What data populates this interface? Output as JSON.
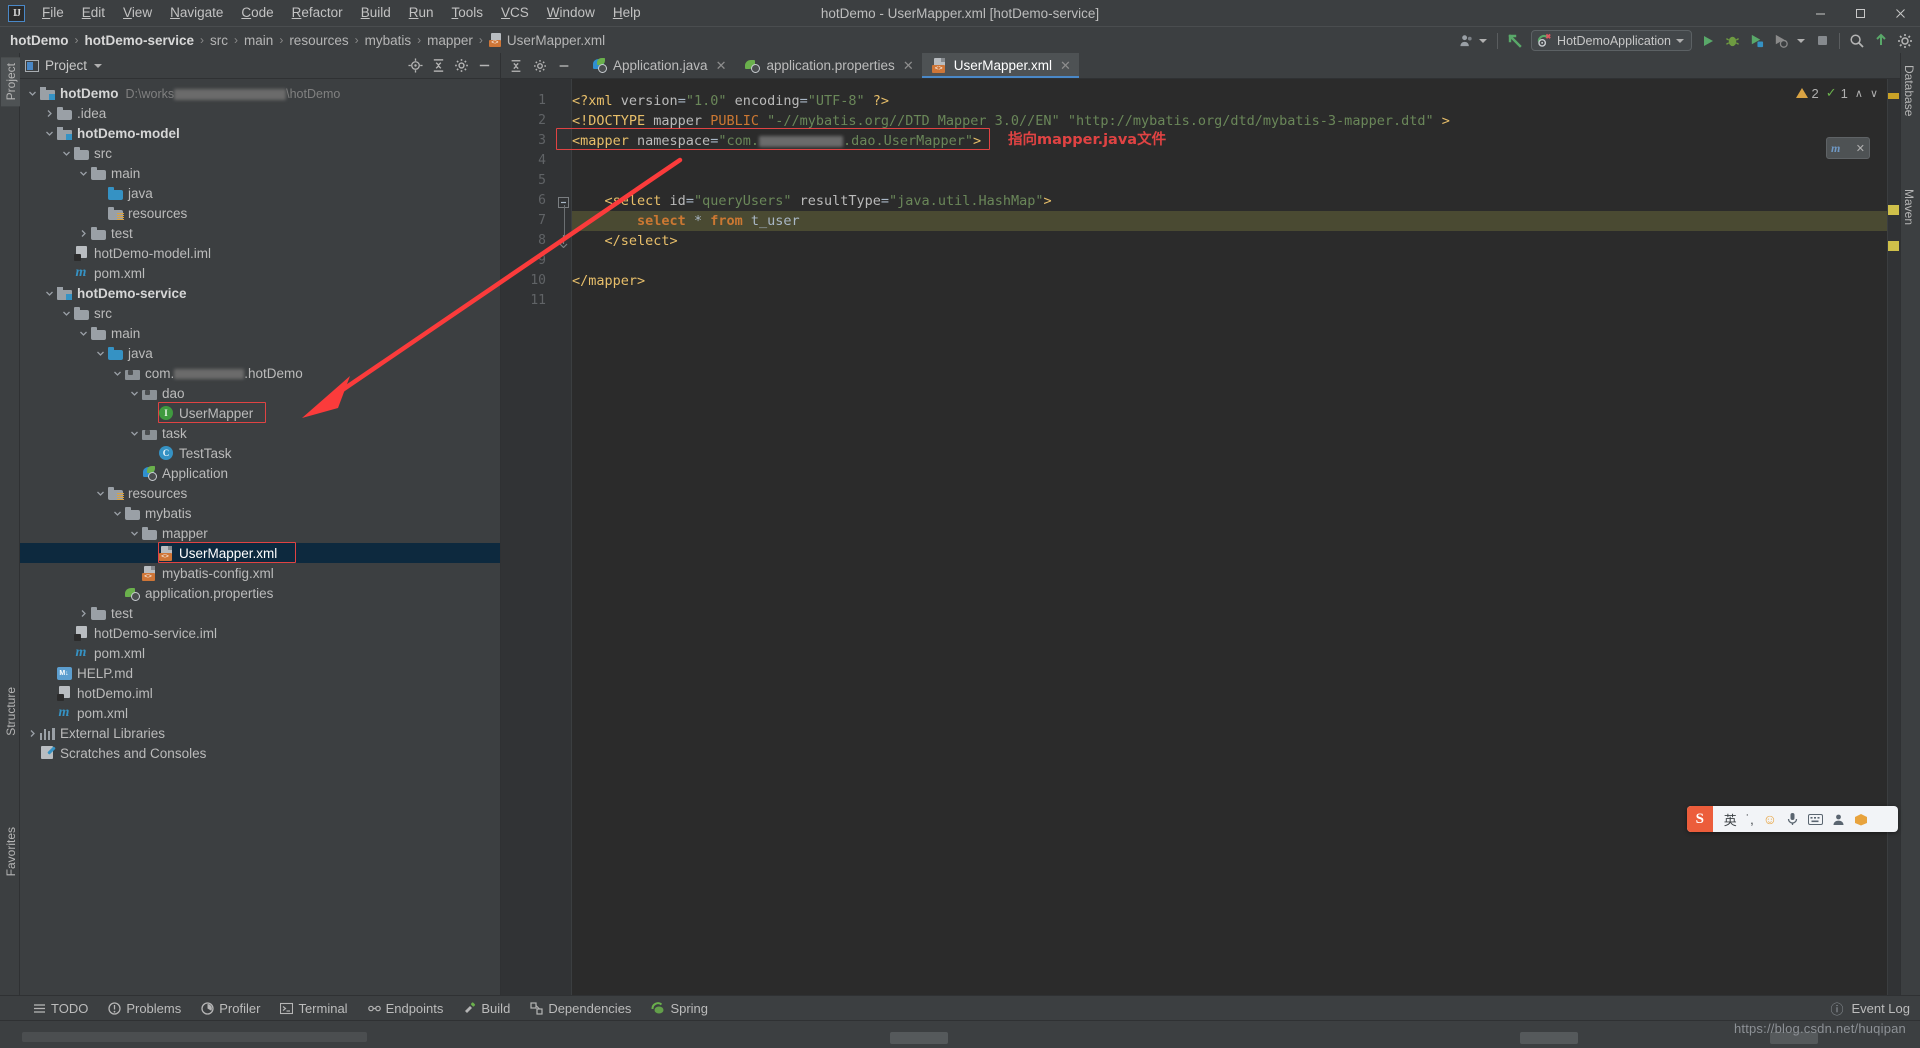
{
  "window": {
    "title": "hotDemo - UserMapper.xml [hotDemo-service]",
    "minimize": "—",
    "maximize": "☐",
    "close": "✕"
  },
  "menu": [
    {
      "label": "File"
    },
    {
      "label": "Edit"
    },
    {
      "label": "View"
    },
    {
      "label": "Navigate"
    },
    {
      "label": "Code"
    },
    {
      "label": "Refactor"
    },
    {
      "label": "Build"
    },
    {
      "label": "Run"
    },
    {
      "label": "Tools"
    },
    {
      "label": "VCS"
    },
    {
      "label": "Window"
    },
    {
      "label": "Help"
    }
  ],
  "breadcrumb": [
    {
      "label": "hotDemo",
      "bold": true
    },
    {
      "label": "hotDemo-service",
      "bold": true
    },
    {
      "label": "src",
      "bold": false
    },
    {
      "label": "main",
      "bold": false
    },
    {
      "label": "resources",
      "bold": false
    },
    {
      "label": "mybatis",
      "bold": false
    },
    {
      "label": "mapper",
      "bold": false
    },
    {
      "label": "UserMapper.xml",
      "bold": false
    }
  ],
  "toolbar": {
    "run_config": "HotDemoApplication",
    "run_tooltip": "Run",
    "debug_tooltip": "Debug",
    "coverage_tooltip": "Run with Coverage",
    "profile_tooltip": "Profile",
    "stop_tooltip": "Stop",
    "search_tooltip": "Search Everywhere",
    "update_tooltip": "Update Project",
    "settings_tooltip": "Settings"
  },
  "project_panel": {
    "title": "Project",
    "locate_icon": "locate-icon",
    "collapse_icon": "collapse-all-icon",
    "settings_icon": "gear-icon",
    "hide_icon": "hide-icon",
    "tree": [
      {
        "depth": 0,
        "label": "hotDemo",
        "path": "D:\\works",
        "path_tail": "\\hotDemo",
        "icon": "module-folder",
        "arrow": "down",
        "bold": true,
        "blur": true
      },
      {
        "depth": 1,
        "label": ".idea",
        "icon": "folder",
        "arrow": "right",
        "bold": false
      },
      {
        "depth": 1,
        "label": "hotDemo-model",
        "icon": "module-folder",
        "arrow": "down",
        "bold": true
      },
      {
        "depth": 2,
        "label": "src",
        "icon": "folder",
        "arrow": "down",
        "bold": false
      },
      {
        "depth": 3,
        "label": "main",
        "icon": "folder",
        "arrow": "down",
        "bold": false
      },
      {
        "depth": 4,
        "label": "java",
        "icon": "source-folder",
        "arrow": "none",
        "bold": false
      },
      {
        "depth": 4,
        "label": "resources",
        "icon": "resource-folder",
        "arrow": "none",
        "bold": false
      },
      {
        "depth": 3,
        "label": "test",
        "icon": "folder",
        "arrow": "right",
        "bold": false
      },
      {
        "depth": 2,
        "label": "hotDemo-model.iml",
        "icon": "iml-file",
        "arrow": "none",
        "bold": false
      },
      {
        "depth": 2,
        "label": "pom.xml",
        "icon": "maven-file",
        "arrow": "none",
        "bold": false
      },
      {
        "depth": 1,
        "label": "hotDemo-service",
        "icon": "module-folder",
        "arrow": "down",
        "bold": true
      },
      {
        "depth": 2,
        "label": "src",
        "icon": "folder",
        "arrow": "down",
        "bold": false
      },
      {
        "depth": 3,
        "label": "main",
        "icon": "folder",
        "arrow": "down",
        "bold": false
      },
      {
        "depth": 4,
        "label": "java",
        "icon": "source-folder",
        "arrow": "down",
        "bold": false
      },
      {
        "depth": 5,
        "label": "com.",
        "label_tail": ".hotDemo",
        "icon": "package",
        "arrow": "down",
        "bold": false,
        "blur": true
      },
      {
        "depth": 6,
        "label": "dao",
        "icon": "package",
        "arrow": "down",
        "bold": false
      },
      {
        "depth": 7,
        "label": "UserMapper",
        "icon": "interface",
        "arrow": "none",
        "bold": false,
        "boxed": true
      },
      {
        "depth": 6,
        "label": "task",
        "icon": "package",
        "arrow": "down",
        "bold": false
      },
      {
        "depth": 7,
        "label": "TestTask",
        "icon": "class",
        "arrow": "none",
        "bold": false
      },
      {
        "depth": 6,
        "label": "Application",
        "icon": "spring-boot",
        "arrow": "none",
        "bold": false
      },
      {
        "depth": 4,
        "label": "resources",
        "icon": "resource-folder",
        "arrow": "down",
        "bold": false
      },
      {
        "depth": 5,
        "label": "mybatis",
        "icon": "folder",
        "arrow": "down",
        "bold": false
      },
      {
        "depth": 6,
        "label": "mapper",
        "icon": "folder",
        "arrow": "down",
        "bold": false
      },
      {
        "depth": 7,
        "label": "UserMapper.xml",
        "icon": "xml-file",
        "arrow": "none",
        "bold": false,
        "selected": true,
        "boxed": true
      },
      {
        "depth": 6,
        "label": "mybatis-config.xml",
        "icon": "xml-file",
        "arrow": "none",
        "bold": false
      },
      {
        "depth": 5,
        "label": "application.properties",
        "icon": "spring-properties",
        "arrow": "none",
        "bold": false
      },
      {
        "depth": 3,
        "label": "test",
        "icon": "folder",
        "arrow": "right",
        "bold": false
      },
      {
        "depth": 2,
        "label": "hotDemo-service.iml",
        "icon": "iml-file",
        "arrow": "none",
        "bold": false
      },
      {
        "depth": 2,
        "label": "pom.xml",
        "icon": "maven-file",
        "arrow": "none",
        "bold": false
      },
      {
        "depth": 1,
        "label": "HELP.md",
        "icon": "markdown-file",
        "arrow": "none",
        "bold": false
      },
      {
        "depth": 1,
        "label": "hotDemo.iml",
        "icon": "iml-file",
        "arrow": "none",
        "bold": false
      },
      {
        "depth": 1,
        "label": "pom.xml",
        "icon": "maven-file",
        "arrow": "none",
        "bold": false
      },
      {
        "depth": 0,
        "label": "External Libraries",
        "icon": "libraries",
        "arrow": "right",
        "bold": false
      },
      {
        "depth": 0,
        "label": "Scratches and Consoles",
        "icon": "scratches",
        "arrow": "none",
        "bold": false
      }
    ]
  },
  "editor": {
    "tabs": [
      {
        "label": "Application.java",
        "icon": "spring-boot",
        "active": false
      },
      {
        "label": "application.properties",
        "icon": "spring-properties",
        "active": false
      },
      {
        "label": "UserMapper.xml",
        "icon": "xml-file",
        "active": true
      }
    ],
    "close_glyph": "✕",
    "line_numbers": [
      "1",
      "2",
      "3",
      "4",
      "5",
      "6",
      "7",
      "8",
      "9",
      "10",
      "11"
    ],
    "lines": [
      {
        "n": 1,
        "segments": [
          {
            "t": "<?xml ",
            "c": "pi"
          },
          {
            "t": "version",
            "c": "at"
          },
          {
            "t": "=",
            "c": "pl"
          },
          {
            "t": "\"1.0\"",
            "c": "sq"
          },
          {
            "t": " encoding",
            "c": "at"
          },
          {
            "t": "=",
            "c": "pl"
          },
          {
            "t": "\"UTF-8\"",
            "c": "sq"
          },
          {
            "t": " ?>",
            "c": "pi"
          }
        ]
      },
      {
        "n": 2,
        "segments": [
          {
            "t": "<!DOCTYPE ",
            "c": "tg"
          },
          {
            "t": "mapper ",
            "c": "at"
          },
          {
            "t": "PUBLIC ",
            "c": "kw"
          },
          {
            "t": "\"-//mybatis.org//DTD Mapper 3.0//EN\"",
            "c": "sq"
          },
          {
            "t": " ",
            "c": "pl"
          },
          {
            "t": "\"http://mybatis.org/dtd/mybatis-3-mapper.dtd\"",
            "c": "sq"
          },
          {
            "t": " >",
            "c": "tg"
          }
        ]
      },
      {
        "n": 3,
        "segments": [
          {
            "t": "<mapper ",
            "c": "tg"
          },
          {
            "t": "namespace",
            "c": "at"
          },
          {
            "t": "=",
            "c": "pl"
          },
          {
            "t": "\"com.",
            "c": "sq"
          },
          {
            "t": "BLUR",
            "c": "blur"
          },
          {
            "t": ".dao.UserMapper\"",
            "c": "sq"
          },
          {
            "t": ">",
            "c": "tg"
          }
        ]
      },
      {
        "n": 4,
        "segments": []
      },
      {
        "n": 5,
        "segments": []
      },
      {
        "n": 6,
        "segments": [
          {
            "t": "    <select ",
            "c": "tg"
          },
          {
            "t": "id",
            "c": "at"
          },
          {
            "t": "=",
            "c": "pl"
          },
          {
            "t": "\"queryUsers\"",
            "c": "sq"
          },
          {
            "t": " resultType",
            "c": "at"
          },
          {
            "t": "=",
            "c": "pl"
          },
          {
            "t": "\"java.util.HashMap\"",
            "c": "sq"
          },
          {
            "t": ">",
            "c": "tg"
          }
        ]
      },
      {
        "n": 7,
        "segments": [
          {
            "t": "        ",
            "c": "pl"
          },
          {
            "t": "select ",
            "c": "kws"
          },
          {
            "t": "* ",
            "c": "pl"
          },
          {
            "t": "from ",
            "c": "kws"
          },
          {
            "t": "t_user",
            "c": "pl"
          }
        ],
        "highlight": true
      },
      {
        "n": 8,
        "segments": [
          {
            "t": "    </select>",
            "c": "tg"
          }
        ]
      },
      {
        "n": 9,
        "segments": []
      },
      {
        "n": 10,
        "segments": [
          {
            "t": "</mapper>",
            "c": "tg"
          }
        ]
      },
      {
        "n": 11,
        "segments": []
      }
    ],
    "inspection": {
      "warnings": "2",
      "checks": "1",
      "up_glyph": "∧",
      "down_glyph": "∨"
    }
  },
  "annotations": {
    "mapper_note": "指向mapper.java文件"
  },
  "left_stripe": [
    {
      "label": "Project",
      "selected": true
    },
    {
      "label": "Structure",
      "selected": false
    },
    {
      "label": "Favorites",
      "selected": false
    }
  ],
  "right_stripe": [
    {
      "label": "Database"
    },
    {
      "label": "m"
    },
    {
      "label": "Maven"
    }
  ],
  "bottom_tabs": [
    {
      "label": "TODO",
      "icon": "todo-icon"
    },
    {
      "label": "Problems",
      "icon": "problems-icon"
    },
    {
      "label": "Profiler",
      "icon": "profiler-icon"
    },
    {
      "label": "Terminal",
      "icon": "terminal-icon"
    },
    {
      "label": "Endpoints",
      "icon": "endpoints-icon"
    },
    {
      "label": "Build",
      "icon": "build-icon"
    },
    {
      "label": "Dependencies",
      "icon": "dependencies-icon"
    },
    {
      "label": "Spring",
      "icon": "spring-icon"
    }
  ],
  "event_log": "Event Log",
  "watermark": "https://blog.csdn.net/huqipan",
  "ime": {
    "logo": "S",
    "lang": "英",
    "punct": "˙,",
    "emoji": "☺",
    "mic": "mic-icon",
    "keyboard": "keyboard-icon",
    "user": "user-icon",
    "box": "box-icon",
    "grid": "grid-icon"
  }
}
